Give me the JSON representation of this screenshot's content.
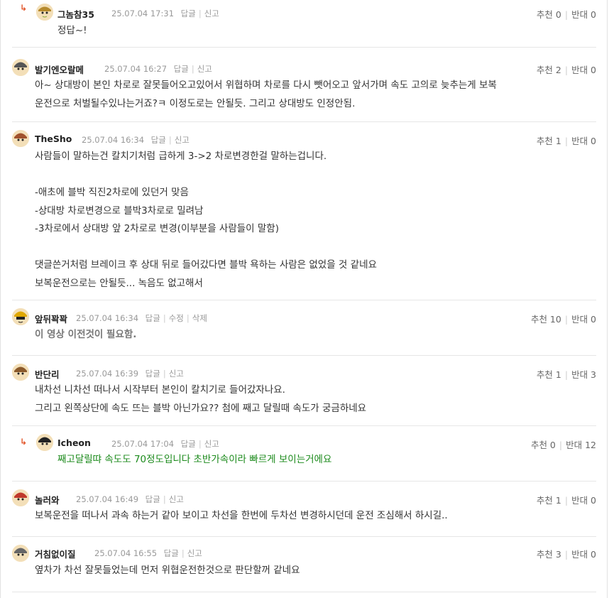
{
  "comments": [
    {
      "nick": "그놈참35",
      "date": "25.07.04 17:31",
      "actions": [
        "답글",
        "신고"
      ],
      "up": "추천 0",
      "down": "반대 0",
      "text": "정답~!"
    },
    {
      "nick": "발기엔오랄메",
      "date": "25.07.04 16:27",
      "actions": [
        "답글",
        "신고"
      ],
      "up": "추천 2",
      "down": "반대 0",
      "text": "아~ 상대방이 본인 차로로 잘못들어오고있어서 위협하며 차로를 다시 뺏어오고 앞서가며 속도 고의로 늦추는게 보복\n운전으로 처벌될수있나는거죠?ㅋ 이정도로는 안될듯. 그리고 상대방도 인정안됨."
    },
    {
      "nick": "TheSho",
      "date": "25.07.04 16:34",
      "actions": [
        "답글",
        "신고"
      ],
      "up": "추천 1",
      "down": "반대 0",
      "text": "사람들이 말하는건 칼치기처럼 급하게 3->2 차로변경한걸 말하는겁니다.\n\n-애초에 블박 직진2차로에 있던거 맞음\n-상대방 차로변경으로 블박3차로로 밀려남\n-3차로에서 상대방 앞 2차로로 변경(이부분을 사람들이 말함)\n\n댓글쓴거처럼 브레이크 후 상대 뒤로 들어갔다면 블박 욕하는 사람은 없었을 것 같네요\n보복운전으로는 안될듯... 녹음도 없고해서"
    },
    {
      "nick": "앞뒤꽉꽉",
      "date": "25.07.04 16:34",
      "actions": [
        "답글",
        "수정",
        "삭제"
      ],
      "up": "추천 10",
      "down": "반대 0",
      "text": "이 영상 이전것이 필요함."
    },
    {
      "nick": "반단리",
      "date": "25.07.04 16:39",
      "actions": [
        "답글",
        "신고"
      ],
      "up": "추천 1",
      "down": "반대 3",
      "text": "내차선 니차선 떠나서 시작부터 본인이 칼치기로 들어갔자나요.\n그리고 왼쪽상단에 속도 뜨는 블박 아닌가요?? 첨에 째고 달릴때 속도가 궁금하네요"
    },
    {
      "nick": "Icheon",
      "date": "25.07.04 17:04",
      "actions": [
        "답글",
        "신고"
      ],
      "up": "추천 0",
      "down": "반대 12",
      "text": "째고달릴땨 속도도 70정도입니다 초반가속이라 빠르게 보이는거에요"
    },
    {
      "nick": "놀러와",
      "date": "25.07.04 16:49",
      "actions": [
        "답글",
        "신고"
      ],
      "up": "추천 1",
      "down": "반대 0",
      "text": "보복운전을 떠나서 과속 하는거 같아 보이고 차선을 한번에 두차선 변경하시던데 운전 조심해서 하시길.."
    },
    {
      "nick": "거침없이질",
      "date": "25.07.04 16:55",
      "actions": [
        "답글",
        "신고"
      ],
      "up": "추천 3",
      "down": "반대 0",
      "text": "옆차가 차선 잘못들었는데 먼저 위협운전한것으로 판단할꺼 같네요"
    }
  ],
  "reply_marker": "↳",
  "colors": {
    "accent": "#e2572c",
    "green": "#1b8a1b"
  }
}
